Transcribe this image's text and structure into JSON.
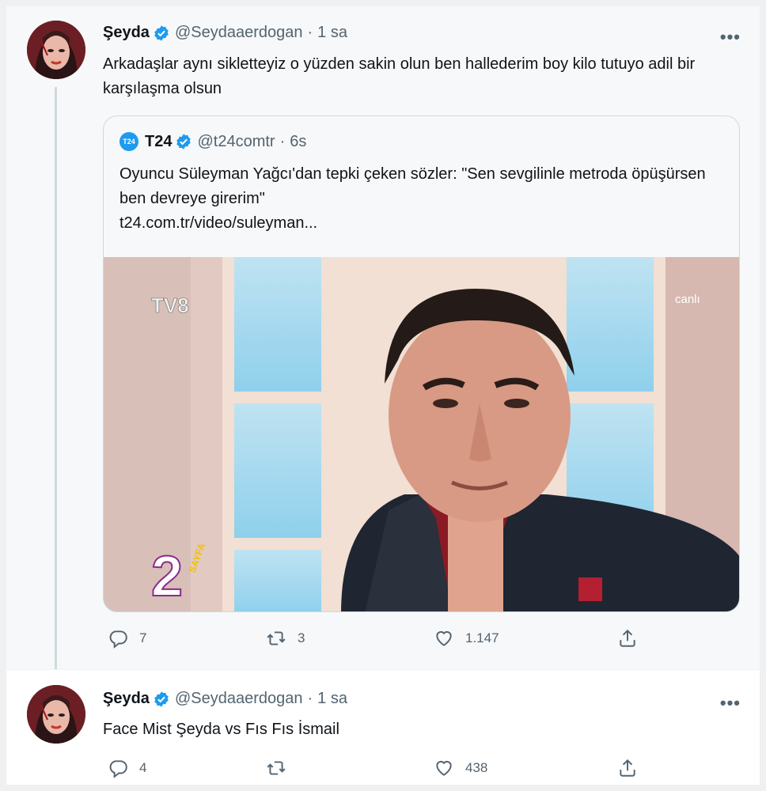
{
  "tweet1": {
    "name": "Şeyda",
    "handle": "@Seydaaerdogan",
    "separator": "·",
    "time": "1 sa",
    "more": "•••",
    "text": "Arkadaşlar aynı sikletteyiz o yüzden sakin olun ben hallederim boy kilo tutuyo adil bir karşılaşma olsun",
    "quote": {
      "logo": "T24",
      "name": "T24",
      "handle": "@t24comtr",
      "separator": "·",
      "time": "6s",
      "text": "Oyuncu Süleyman Yağcı'dan tepki çeken sözler: \"Sen sevgilinle metroda öpüşürsen ben devreye girerim\"",
      "link": "t24.com.tr/video/suleyman...",
      "media": {
        "channel_logo": "TV8",
        "live_label": "canlı",
        "show_logo_number": "2",
        "show_logo_word": "SAYFA"
      }
    },
    "actions": {
      "replies": "7",
      "retweets": "3",
      "likes": "1.147"
    }
  },
  "tweet2": {
    "name": "Şeyda",
    "handle": "@Seydaaerdogan",
    "separator": "·",
    "time": "1 sa",
    "more": "•••",
    "text": "Face Mist Şeyda vs Fıs Fıs İsmail",
    "actions": {
      "replies": "4",
      "retweets": "",
      "likes": "438"
    }
  },
  "colors": {
    "accent": "#1d9bf0",
    "muted": "#536471",
    "text": "#0f1419",
    "thread_line": "#cfd9de"
  },
  "icons": [
    "avatar",
    "verified-badge-icon",
    "reply-icon",
    "retweet-icon",
    "like-icon",
    "share-icon",
    "more-icon"
  ]
}
